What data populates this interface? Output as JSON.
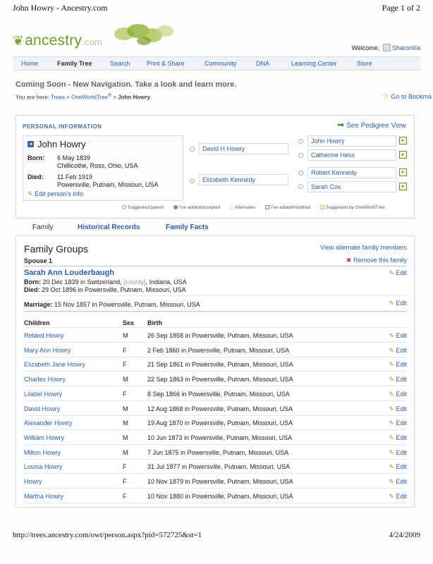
{
  "print": {
    "title": "John Howry - Ancestry.com",
    "page": "Page 1 of 2",
    "url": "http://trees.ancestry.com/owt/person.aspx?pid=572725&st=1",
    "date": "4/24/2009"
  },
  "header": {
    "logo_text": "ancestry",
    "logo_suffix": ".com",
    "welcome": "Welcome,",
    "username": "Sharonlila"
  },
  "nav": {
    "items": [
      "Home",
      "Family Tree",
      "Search",
      "Print & Share",
      "Community",
      "DNA",
      "Learning Center",
      "Store"
    ],
    "active": "Family Tree"
  },
  "promo": "Coming Soon - New Navigation.  Take a look and learn more.",
  "breadcrumb": {
    "prefix": "You are here:",
    "trees": "Trees",
    "tree": "OneWorldTree",
    "reg": "®",
    "current": "John Howry"
  },
  "bookmark": "Go to Bookma",
  "personal": {
    "title": "PERSONAL INFORMATION",
    "pedigree": "See Pedigree View",
    "name": "John Howry",
    "born_label": "Born:",
    "born_date": "6 May 1839",
    "born_place": "Chillicothe, Ross, Ohio, USA",
    "died_label": "Died:",
    "died_date": "11 Feb 1919",
    "died_place": "Powersville, Putnam, Missouri, USA",
    "edit": "Edit person's info",
    "parents": [
      "David H Howry",
      "Elizabeth Kennedy"
    ],
    "grandparents": [
      "John Howry",
      "Catherine Hess",
      "Robert Kennedy",
      "Sarah Cox"
    ]
  },
  "legend": [
    "Suggested parent",
    "I've added/accepted",
    "Alternates",
    "I've added/modified",
    "Suggested by OneWorldTree"
  ],
  "tabs": [
    "Family",
    "Historical Records",
    "Family Facts"
  ],
  "family": {
    "title": "Family Groups",
    "alt_link": "View alternate family members",
    "spouse_label": "Spouse 1",
    "remove": "Remove this family",
    "spouse_name": "Sarah Ann Louderbaugh",
    "born_label": "Born:",
    "born_pre": "20 Dec 1839 in Switzerland,",
    "born_county": "[county]",
    "born_post": ", Indiana, USA",
    "died_label": "Died:",
    "died_text": "29 Oct 1896 in Powersville, Putnam, Missouri, USA",
    "marriage_label": "Marriage:",
    "marriage_text": "15 Nov 1857 in Powersville, Putnam, Missouri, USA",
    "edit_label": "Edit",
    "headers": {
      "children": "Children",
      "sex": "Sex",
      "birth": "Birth"
    },
    "children": [
      {
        "name": "Roland Howry",
        "sex": "M",
        "birth": "26 Sep 1858 in Powersville, Putnam, Missouri, USA"
      },
      {
        "name": "Mary Ann Howry",
        "sex": "F",
        "birth": "2 Feb 1860 in Powersville, Putnam, Missouri, USA"
      },
      {
        "name": "Elizabeth Jane Howry",
        "sex": "F",
        "birth": "21 Sep 1861 in Powersville, Putnam, Missouri, USA"
      },
      {
        "name": "Charles Howry",
        "sex": "M",
        "birth": "22 Sep 1863 in Powersville, Putnam, Missouri, USA"
      },
      {
        "name": "Lilabel Howry",
        "sex": "F",
        "birth": "8 Sep 1866 in Powersville, Putnam, Missouri, USA"
      },
      {
        "name": "David Howry",
        "sex": "M",
        "birth": "12 Aug 1868 in Powersville, Putnam, Missouri, USA"
      },
      {
        "name": "Alexander Howry",
        "sex": "M",
        "birth": "19 Aug 1870 in Powersville, Putnam, Missouri, USA"
      },
      {
        "name": "William Howry",
        "sex": "M",
        "birth": "10 Jun 1873 in Powersville, Putnam, Missouri, USA"
      },
      {
        "name": "Milton Howry",
        "sex": "M",
        "birth": "7 Jun 1875 in Powersville, Putnam, Missouri, USA"
      },
      {
        "name": "Louisa Howry",
        "sex": "F",
        "birth": "31 Jul 1877 in Powersville, Putnam, Missouri, USA"
      },
      {
        "name": "Howry",
        "sex": "F",
        "birth": "10 Nov 1879 in Powersville, Putnam, Missouri, USA"
      },
      {
        "name": "Martha Howry",
        "sex": "F",
        "birth": "10 Nov 1880 in Powersville, Putnam, Missouri, USA"
      }
    ]
  },
  "colors": {
    "link": "#2a5fa8",
    "brand_green": "#6f9a2a"
  }
}
